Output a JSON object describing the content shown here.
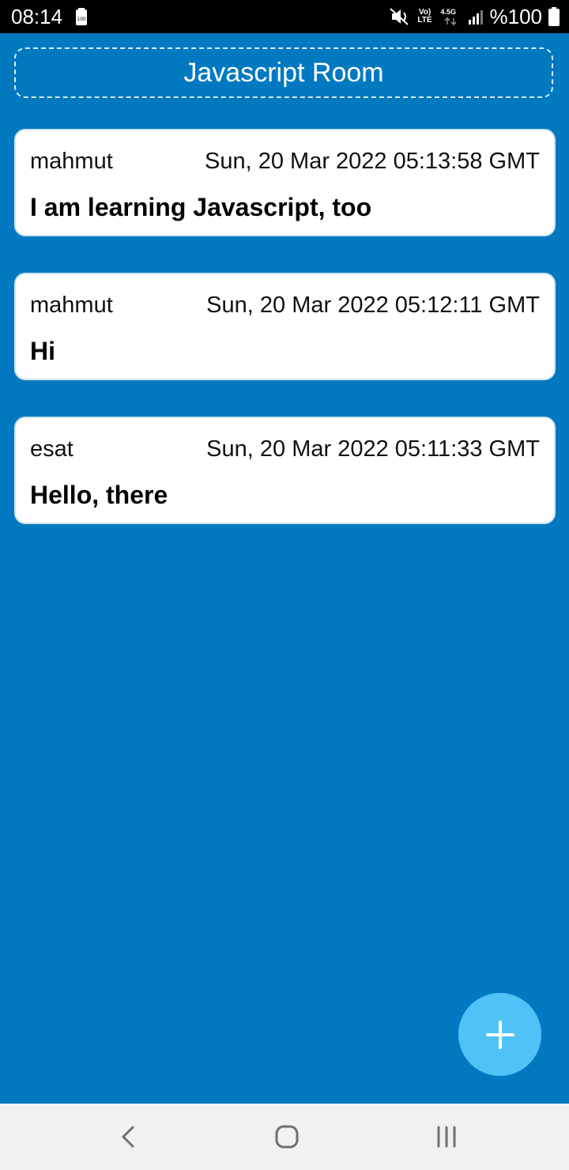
{
  "status_bar": {
    "time": "08:14",
    "battery_percent": "%100",
    "volte_top": "Vo)",
    "volte_bottom": "LTE",
    "network": "4.5G"
  },
  "room": {
    "title": "Javascript Room"
  },
  "messages": [
    {
      "author": "mahmut",
      "timestamp": "Sun, 20 Mar 2022 05:13:58 GMT",
      "text": "I am learning Javascript, too"
    },
    {
      "author": "mahmut",
      "timestamp": "Sun, 20 Mar 2022 05:12:11 GMT",
      "text": "Hi"
    },
    {
      "author": "esat",
      "timestamp": "Sun, 20 Mar 2022 05:11:33 GMT",
      "text": "Hello, there"
    }
  ],
  "fab": {
    "icon": "plus-icon"
  },
  "nav_bar": {
    "back_icon": "chevron-left-icon",
    "home_icon": "home-icon",
    "recents_icon": "recents-icon"
  },
  "colors": {
    "background": "#0079c1",
    "card": "#ffffff",
    "fab": "#4fc3f7",
    "status_bar": "#000000",
    "nav_bar": "#f1f1f1"
  }
}
